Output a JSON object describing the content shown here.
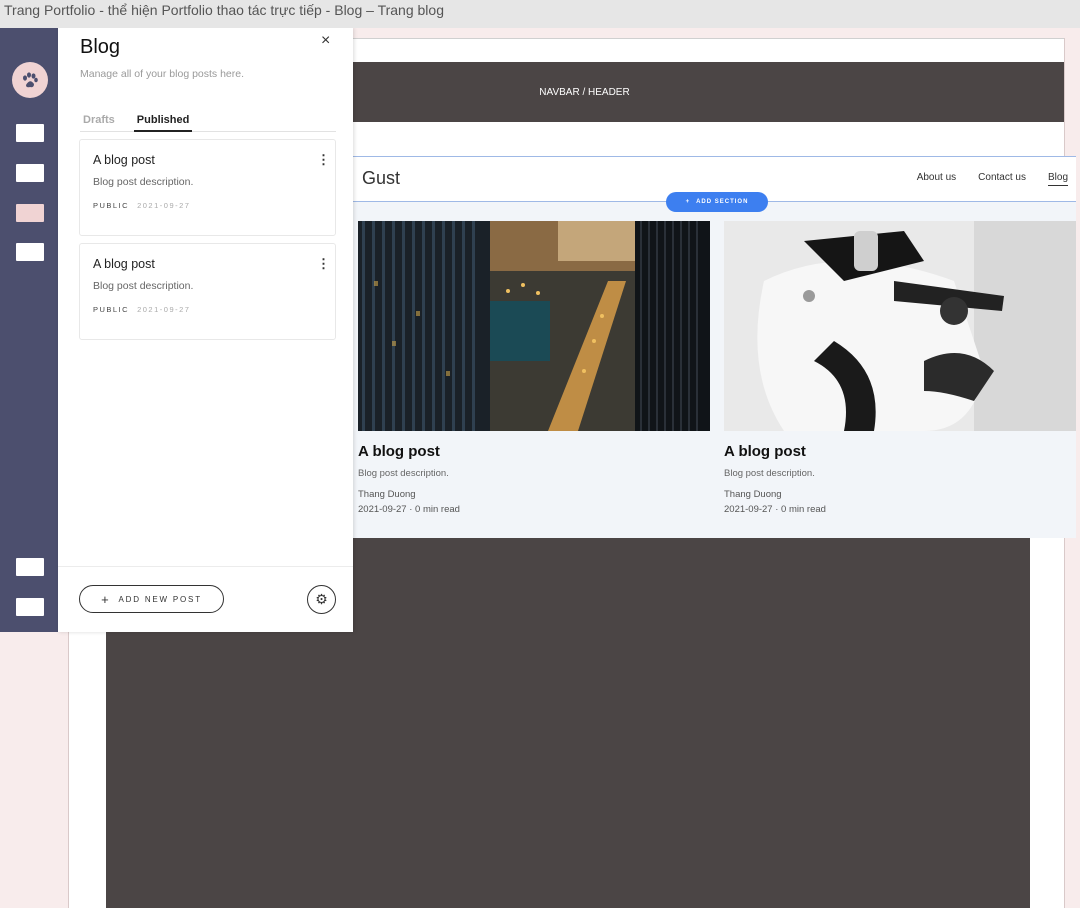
{
  "window": {
    "title": "Trang Portfolio - thể hiện Portfolio thao tác trực tiếp - Blog – Trang blog"
  },
  "rail": {
    "logo_icon": "paw-icon",
    "brand_color": "#4c4f6e",
    "accent_color": "#f0d3d3",
    "buttons": [
      "button-1",
      "button-2",
      "button-3",
      "button-4",
      "button-5",
      "button-6"
    ],
    "active_index": 2
  },
  "panel": {
    "title": "Blog",
    "close_glyph": "×",
    "subtitle": "Manage all of your blog posts here.",
    "tabs": [
      {
        "label": "Drafts",
        "active": false
      },
      {
        "label": "Published",
        "active": true
      }
    ],
    "posts": [
      {
        "title": "A blog post",
        "description": "Blog post description.",
        "status": "PUBLIC",
        "date": "2021-09-27",
        "menu_glyph": "⋮"
      },
      {
        "title": "A blog post",
        "description": "Blog post description.",
        "status": "PUBLIC",
        "date": "2021-09-27",
        "menu_glyph": "⋮"
      }
    ],
    "add_post_plus": "+",
    "add_post_label": "ADD NEW POST",
    "settings_glyph": "⚙"
  },
  "canvas": {
    "navbar_label": "NAVBAR / HEADER",
    "site_logo": "Gust",
    "nav_items": [
      "About us",
      "Contact us",
      "Blog"
    ],
    "active_nav": "Blog",
    "add_section_plus": "+",
    "add_section_label": "ADD SECTION",
    "add_section_color": "#3d7ff0",
    "cards": [
      {
        "title": "A blog post",
        "description": "Blog post description.",
        "author": "Thang Duong",
        "meta": "2021-09-27 · 0 min read",
        "image": "city-skyline-night-photo"
      },
      {
        "title": "A blog post",
        "description": "Blog post description.",
        "author": "Thang Duong",
        "meta": "2021-09-27 · 0 min read",
        "image": "white-motorcycle-photo"
      }
    ],
    "block_color": "#4b4545"
  }
}
